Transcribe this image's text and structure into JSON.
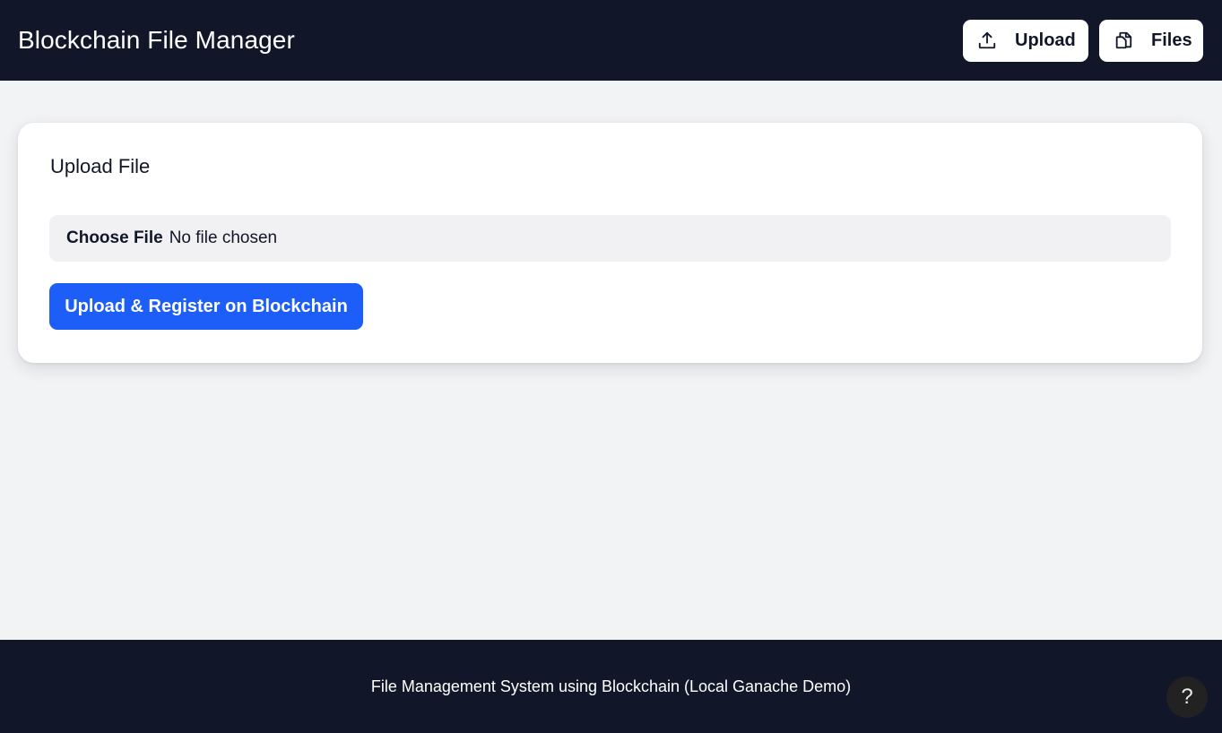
{
  "header": {
    "title": "Blockchain File Manager",
    "nav": {
      "upload_label": "Upload",
      "upload_icon": "upload-icon",
      "files_label": "Files",
      "files_icon": "files-icon"
    }
  },
  "card": {
    "title": "Upload File",
    "file_input": {
      "button_label": "Choose File",
      "status": "No file chosen"
    },
    "submit_label": "Upload & Register on Blockchain"
  },
  "footer": {
    "text": "File Management System using Blockchain (Local Ganache Demo)"
  },
  "help": {
    "label": "?"
  },
  "colors": {
    "header_bg": "#111729",
    "page_bg": "#f2f3f5",
    "accent": "#1d5ef9",
    "card_bg": "#ffffff"
  }
}
